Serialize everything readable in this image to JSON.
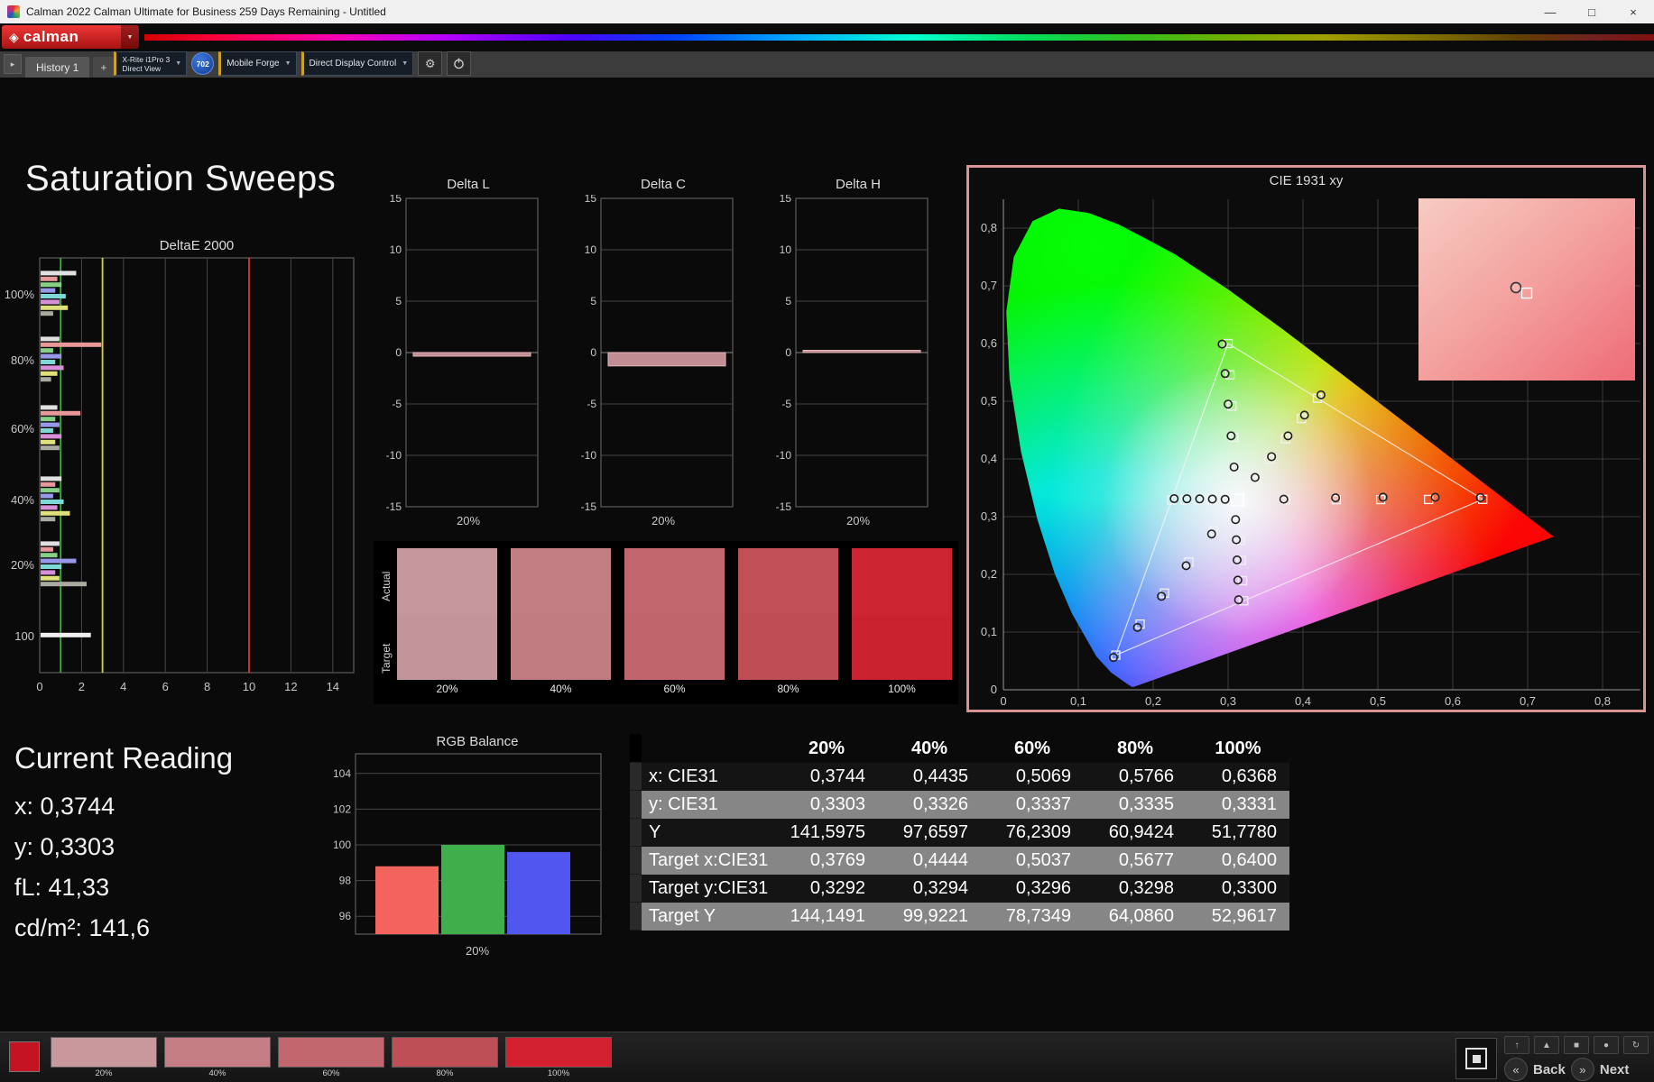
{
  "titlebar": {
    "title": "Calman 2022 Calman Ultimate for Business 259 Days Remaining  - Untitled",
    "minimize": "—",
    "maximize": "□",
    "close": "×"
  },
  "brand": {
    "logo": "calman"
  },
  "icons": {
    "caret_down": "▼",
    "tab_expand": "▸",
    "gear": "⚙",
    "back": "«",
    "next": "»",
    "logo_diamond": "◈"
  },
  "tabbar": {
    "history_tab": "History 1",
    "add_tab": "+",
    "meter_line1": "X-Rite i1Pro 3",
    "meter_line2": "Direct View",
    "badge": "702",
    "source": "Mobile Forge",
    "display_control": "Direct Display Control"
  },
  "heading": "Saturation Sweeps",
  "deltae_chart": {
    "title": "DeltaE 2000",
    "xticks": [
      0,
      2,
      4,
      6,
      8,
      10,
      12,
      14
    ],
    "xmax": 15,
    "ref_lines": [
      {
        "value": 1,
        "color": "#2db82d"
      },
      {
        "value": 3,
        "color": "#d6d62a"
      },
      {
        "value": 10,
        "color": "#e23030"
      }
    ],
    "groups": [
      {
        "label": "100%",
        "bars": [
          {
            "c": "#e0e0e0",
            "v": 1.7
          },
          {
            "c": "#e89898",
            "v": 0.8
          },
          {
            "c": "#86d086",
            "v": 1.0
          },
          {
            "c": "#9898ea",
            "v": 0.7
          },
          {
            "c": "#7fd8d8",
            "v": 1.2
          },
          {
            "c": "#d88fd8",
            "v": 0.9
          },
          {
            "c": "#e0e07a",
            "v": 1.3
          },
          {
            "c": "#aaaaa0",
            "v": 0.6
          }
        ]
      },
      {
        "label": "80%",
        "bars": [
          {
            "c": "#e0e0e0",
            "v": 0.9
          },
          {
            "c": "#e89898",
            "v": 2.9
          },
          {
            "c": "#86d086",
            "v": 0.6
          },
          {
            "c": "#9898ea",
            "v": 1.0
          },
          {
            "c": "#7fd8d8",
            "v": 0.7
          },
          {
            "c": "#d88fd8",
            "v": 1.1
          },
          {
            "c": "#e0e07a",
            "v": 0.8
          },
          {
            "c": "#aaaaa0",
            "v": 0.5
          }
        ]
      },
      {
        "label": "60%",
        "bars": [
          {
            "c": "#e0e0e0",
            "v": 0.8
          },
          {
            "c": "#e89898",
            "v": 1.9
          },
          {
            "c": "#86d086",
            "v": 0.7
          },
          {
            "c": "#9898ea",
            "v": 0.9
          },
          {
            "c": "#7fd8d8",
            "v": 0.6
          },
          {
            "c": "#d88fd8",
            "v": 1.0
          },
          {
            "c": "#e0e07a",
            "v": 0.7
          },
          {
            "c": "#aaaaa0",
            "v": 0.9
          }
        ]
      },
      {
        "label": "40%",
        "bars": [
          {
            "c": "#e0e0e0",
            "v": 1.0
          },
          {
            "c": "#e89898",
            "v": 0.7
          },
          {
            "c": "#86d086",
            "v": 0.9
          },
          {
            "c": "#9898ea",
            "v": 0.6
          },
          {
            "c": "#7fd8d8",
            "v": 1.1
          },
          {
            "c": "#d88fd8",
            "v": 0.8
          },
          {
            "c": "#e0e07a",
            "v": 1.4
          },
          {
            "c": "#aaaaa0",
            "v": 0.7
          }
        ]
      },
      {
        "label": "20%",
        "bars": [
          {
            "c": "#e0e0e0",
            "v": 0.9
          },
          {
            "c": "#e89898",
            "v": 0.6
          },
          {
            "c": "#86d086",
            "v": 0.8
          },
          {
            "c": "#9898ea",
            "v": 1.7
          },
          {
            "c": "#7fd8d8",
            "v": 1.0
          },
          {
            "c": "#d88fd8",
            "v": 0.7
          },
          {
            "c": "#e0e07a",
            "v": 0.9
          },
          {
            "c": "#aaaaa0",
            "v": 2.2
          }
        ]
      },
      {
        "label": "100",
        "bars": [
          {
            "c": "#f0f0f0",
            "v": 2.4
          }
        ]
      }
    ]
  },
  "delta_axis": {
    "yticks": [
      15,
      10,
      5,
      0,
      -5,
      -10,
      -15
    ]
  },
  "delta_charts": [
    {
      "title": "Delta L",
      "xlabel": "20%",
      "value": -0.35
    },
    {
      "title": "Delta C",
      "xlabel": "20%",
      "value": -1.3
    },
    {
      "title": "Delta H",
      "xlabel": "20%",
      "value": 0.12
    }
  ],
  "swatch_panel": {
    "row_labels": [
      "Actual",
      "Target"
    ],
    "labels": [
      "20%",
      "40%",
      "60%",
      "80%",
      "100%"
    ],
    "actual": [
      "#c5989d",
      "#c37e83",
      "#c2676d",
      "#c04f58",
      "#cd2531"
    ],
    "target": [
      "#c2959a",
      "#c17c81",
      "#c0656b",
      "#be4d56",
      "#ca232f"
    ]
  },
  "cie_chart": {
    "title": "CIE 1931 xy",
    "xticks": [
      "0",
      "0,1",
      "0,2",
      "0,3",
      "0,4",
      "0,5",
      "0,6",
      "0,7",
      "0,8"
    ],
    "yticks": [
      "0",
      "0,1",
      "0,2",
      "0,3",
      "0,4",
      "0,5",
      "0,6",
      "0,7",
      "0,8"
    ],
    "triangle": [
      [
        0.64,
        0.33
      ],
      [
        0.3,
        0.6
      ],
      [
        0.15,
        0.06
      ]
    ],
    "white_point": [
      0.3127,
      0.329
    ],
    "targets": [
      [
        0.3769,
        0.3292
      ],
      [
        0.4444,
        0.3294
      ],
      [
        0.5037,
        0.3296
      ],
      [
        0.5677,
        0.3298
      ],
      [
        0.64,
        0.33
      ],
      [
        0.3102,
        0.3832
      ],
      [
        0.3076,
        0.4374
      ],
      [
        0.3051,
        0.4916
      ],
      [
        0.3025,
        0.5458
      ],
      [
        0.3,
        0.6
      ],
      [
        0.2802,
        0.2752
      ],
      [
        0.2476,
        0.2214
      ],
      [
        0.2151,
        0.1676
      ],
      [
        0.1825,
        0.1138
      ],
      [
        0.15,
        0.06
      ],
      [
        0.334,
        0.3642
      ],
      [
        0.3553,
        0.3995
      ],
      [
        0.3766,
        0.4348
      ],
      [
        0.398,
        0.4701
      ],
      [
        0.4193,
        0.5053
      ],
      [
        0.2951,
        0.3289
      ],
      [
        0.2775,
        0.3289
      ],
      [
        0.2599,
        0.3288
      ],
      [
        0.2423,
        0.3288
      ],
      [
        0.2246,
        0.3287
      ],
      [
        0.3143,
        0.294
      ],
      [
        0.316,
        0.259
      ],
      [
        0.3176,
        0.2241
      ],
      [
        0.3193,
        0.1891
      ],
      [
        0.3209,
        0.1542
      ]
    ],
    "actuals": [
      [
        0.3744,
        0.3303
      ],
      [
        0.4435,
        0.3326
      ],
      [
        0.5069,
        0.3337
      ],
      [
        0.5766,
        0.3335
      ],
      [
        0.6368,
        0.3331
      ],
      [
        0.308,
        0.386
      ],
      [
        0.304,
        0.44
      ],
      [
        0.3,
        0.495
      ],
      [
        0.296,
        0.548
      ],
      [
        0.292,
        0.599
      ],
      [
        0.278,
        0.27
      ],
      [
        0.244,
        0.215
      ],
      [
        0.211,
        0.162
      ],
      [
        0.179,
        0.108
      ],
      [
        0.147,
        0.056
      ],
      [
        0.336,
        0.368
      ],
      [
        0.358,
        0.404
      ],
      [
        0.38,
        0.44
      ],
      [
        0.402,
        0.476
      ],
      [
        0.424,
        0.511
      ],
      [
        0.296,
        0.33
      ],
      [
        0.279,
        0.3305
      ],
      [
        0.262,
        0.3308
      ],
      [
        0.245,
        0.331
      ],
      [
        0.228,
        0.3312
      ],
      [
        0.31,
        0.295
      ],
      [
        0.311,
        0.26
      ],
      [
        0.312,
        0.225
      ],
      [
        0.313,
        0.19
      ],
      [
        0.314,
        0.156
      ]
    ],
    "inset": {
      "from": "#f7ccc2",
      "to": "#ee6b77",
      "circle": [
        0.45,
        0.49
      ],
      "square": [
        0.5,
        0.52
      ]
    }
  },
  "current_reading": {
    "title": "Current Reading",
    "lines": [
      "x: 0,3744",
      "y: 0,3303",
      "fL: 41,33",
      "cd/m²: 141,6"
    ]
  },
  "rgb_chart": {
    "title": "RGB Balance",
    "xlabel": "20%",
    "yticks": [
      96,
      98,
      100,
      102,
      104
    ],
    "ymin": 95,
    "ymax": 105.1,
    "bars": [
      {
        "name": "R",
        "value": 98.8,
        "color": "#f4645e"
      },
      {
        "name": "G",
        "value": 100.0,
        "color": "#3faf4b"
      },
      {
        "name": "B",
        "value": 99.6,
        "color": "#5157ee"
      }
    ]
  },
  "data_table": {
    "columns": [
      "20%",
      "40%",
      "60%",
      "80%",
      "100%"
    ],
    "rows": [
      {
        "label": "x: CIE31",
        "values": [
          "0,3744",
          "0,4435",
          "0,5069",
          "0,5766",
          "0,6368"
        ]
      },
      {
        "label": "y: CIE31",
        "values": [
          "0,3303",
          "0,3326",
          "0,3337",
          "0,3335",
          "0,3331"
        ]
      },
      {
        "label": "Y",
        "values": [
          "141,5975",
          "97,6597",
          "76,2309",
          "60,9424",
          "51,7780"
        ]
      },
      {
        "label": "Target x:CIE31",
        "values": [
          "0,3769",
          "0,4444",
          "0,5037",
          "0,5677",
          "0,6400"
        ]
      },
      {
        "label": "Target y:CIE31",
        "values": [
          "0,3292",
          "0,3294",
          "0,3296",
          "0,3298",
          "0,3300"
        ]
      },
      {
        "label": "Target Y",
        "values": [
          "144,1491",
          "99,9221",
          "78,7349",
          "64,0860",
          "52,9617"
        ]
      }
    ]
  },
  "bottombar": {
    "thumbs": [
      {
        "label": "20%",
        "color": "#c9989d"
      },
      {
        "label": "40%",
        "color": "#c57f84"
      },
      {
        "label": "60%",
        "color": "#c2676d"
      },
      {
        "label": "80%",
        "color": "#bf4f57"
      },
      {
        "label": "100%",
        "color": "#d2202e"
      }
    ],
    "transport_icons": [
      {
        "name": "arrow-up-button",
        "glyph": "↑"
      },
      {
        "name": "eject-button",
        "glyph": "▲"
      },
      {
        "name": "stop-button",
        "glyph": "■"
      },
      {
        "name": "record-button",
        "glyph": "●"
      },
      {
        "name": "refresh-button",
        "glyph": "↻"
      }
    ],
    "back": "Back",
    "next": "Next"
  }
}
